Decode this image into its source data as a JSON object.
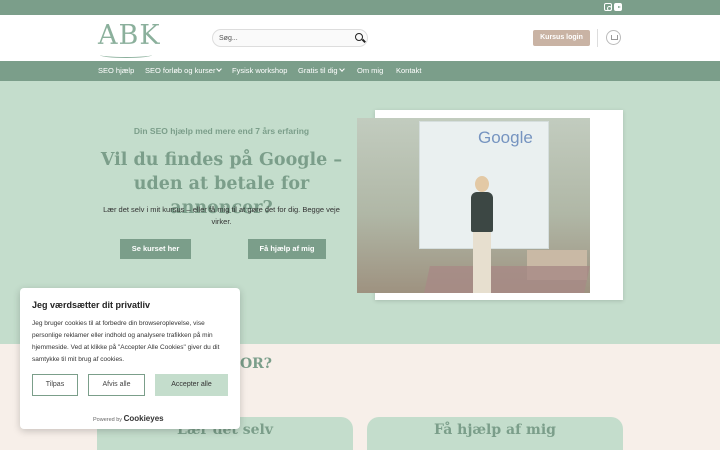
{
  "header": {
    "logo": "ABK",
    "search_placeholder": "Søg...",
    "login_label": "Kursus login",
    "social": [
      "instagram-icon",
      "youtube-icon"
    ]
  },
  "nav": {
    "items": [
      {
        "label": "SEO hjælp",
        "dropdown": false
      },
      {
        "label": "SEO forløb og kurser",
        "dropdown": true
      },
      {
        "label": "Fysisk workshop",
        "dropdown": false
      },
      {
        "label": "Gratis til dig",
        "dropdown": true
      },
      {
        "label": "Om mig",
        "dropdown": false
      },
      {
        "label": "Kontakt",
        "dropdown": false
      }
    ]
  },
  "hero": {
    "kicker": "Din SEO hjælp med mere end 7 års erfaring",
    "headline": "Vil du findes på Google – uden at betale for annoncer?",
    "lead": "Lær det selv i mit kursus – eller få mig til at gøre det for dig. Begge veje virker.",
    "cta_primary": "Se kurset her",
    "cta_secondary": "Få hjælp af mig",
    "photo_screen_text": "Google"
  },
  "section": {
    "heading_peek": "FOR?",
    "cards": [
      "Lær det selv",
      "Få hjælp af mig"
    ]
  },
  "cookie": {
    "title": "Jeg værdsætter dit privatliv",
    "text": "Jeg bruger cookies til at forbedre din browseroplevelse, vise personlige reklamer eller indhold og analysere trafikken på min hjemmeside. Ved at klikke på \"Accepter Alle Cookies\" giver du dit samtykke til mit brug af cookies.",
    "btn_customize": "Tilpas",
    "btn_reject": "Afvis alle",
    "btn_accept": "Accepter alle",
    "powered_prefix": "Powered by",
    "powered_brand": "Cookieyes"
  },
  "colors": {
    "brand_green": "#7b9e8a",
    "hero_bg": "#c4ddcc",
    "login_btn": "#c9b3a4",
    "page_bg": "#f7efe9"
  }
}
